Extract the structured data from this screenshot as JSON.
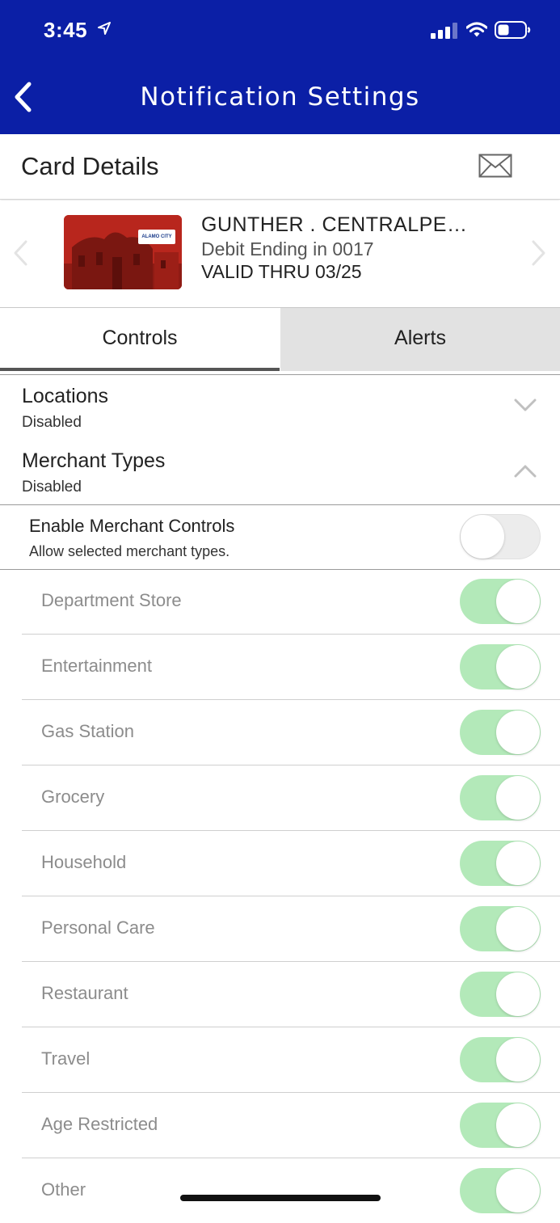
{
  "status_bar": {
    "time": "3:45",
    "icons": [
      "location-arrow-icon",
      "cellular-signal-icon",
      "wifi-icon",
      "battery-icon"
    ]
  },
  "nav": {
    "title": "Notification Settings",
    "back_icon": "chevron-left-icon"
  },
  "card_header": {
    "title": "Card Details",
    "icon": "mail-icon"
  },
  "card": {
    "name": "GUNTHER . CENTRALPE…",
    "subtitle": "Debit Ending in 0017",
    "valid": "VALID THRU 03/25",
    "logo_text": "ALAMO CITY"
  },
  "tabs": [
    {
      "label": "Controls",
      "selected": true
    },
    {
      "label": "Alerts",
      "selected": false
    }
  ],
  "sections": {
    "locations": {
      "title": "Locations",
      "status": "Disabled",
      "expanded": false
    },
    "merchant_types": {
      "title": "Merchant Types",
      "status": "Disabled",
      "expanded": true
    }
  },
  "enable_merchant": {
    "title": "Enable Merchant Controls",
    "subtitle": "Allow selected merchant types.",
    "enabled": false
  },
  "merchant_types": [
    {
      "label": "Department Store",
      "on": true
    },
    {
      "label": "Entertainment",
      "on": true
    },
    {
      "label": "Gas Station",
      "on": true
    },
    {
      "label": "Grocery",
      "on": true
    },
    {
      "label": "Household",
      "on": true
    },
    {
      "label": "Personal Care",
      "on": true
    },
    {
      "label": "Restaurant",
      "on": true
    },
    {
      "label": "Travel",
      "on": true
    },
    {
      "label": "Age Restricted",
      "on": true
    },
    {
      "label": "Other",
      "on": true
    }
  ],
  "colors": {
    "header_blue": "#0b1fa6",
    "toggle_on": "#b3e9b9",
    "tab_inactive": "#e2e2e2"
  }
}
